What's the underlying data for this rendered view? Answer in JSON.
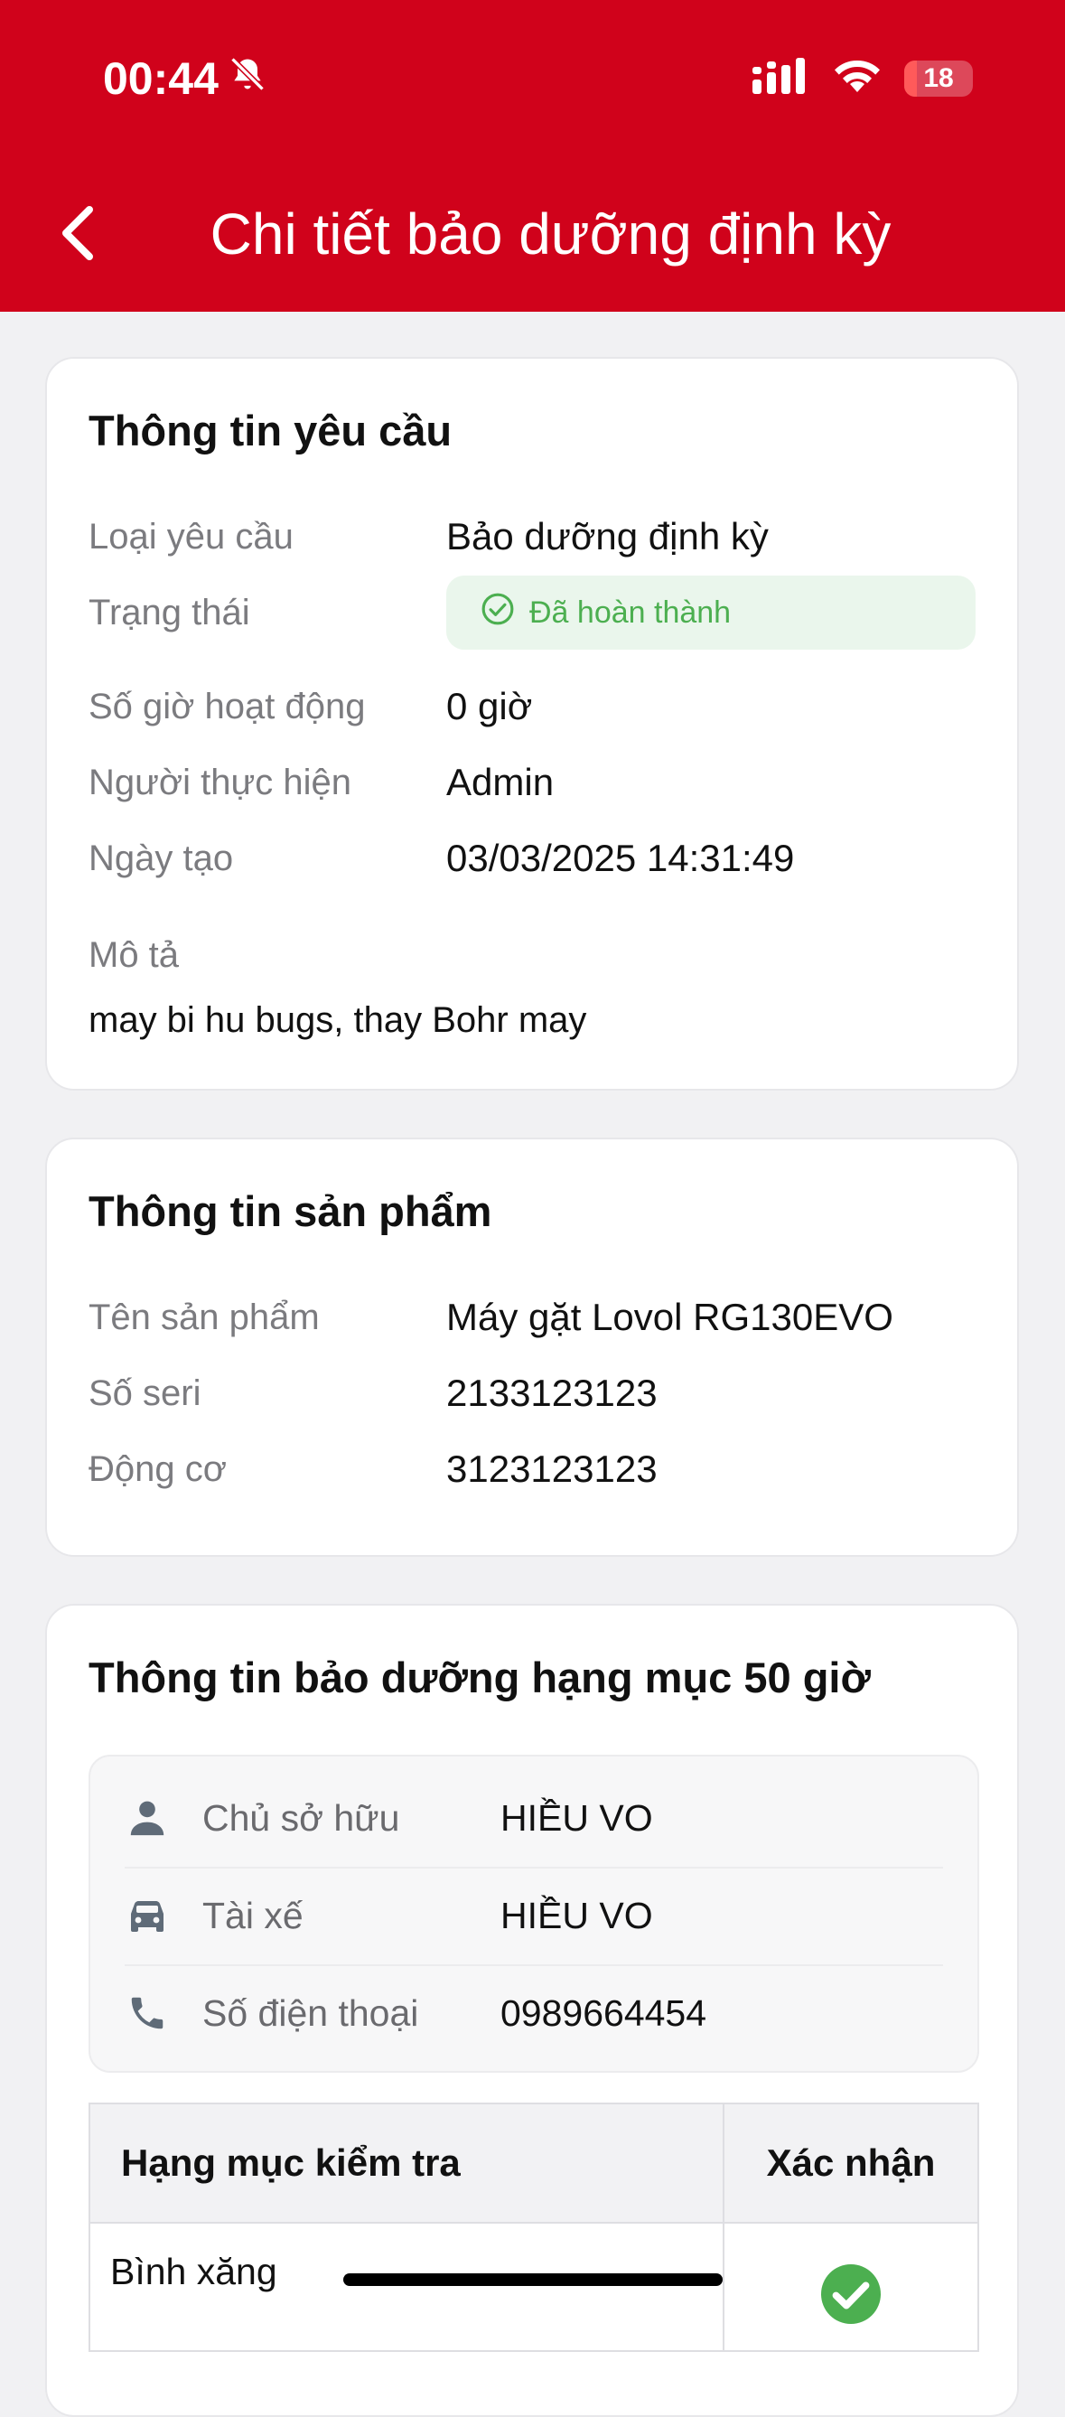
{
  "status_bar": {
    "time": "00:44",
    "battery": "18"
  },
  "nav": {
    "title": "Chi tiết bảo dưỡng định kỳ",
    "back_icon": "chevron-left-icon"
  },
  "request_info": {
    "title": "Thông tin yêu cầu",
    "rows": [
      {
        "label": "Loại yêu cầu",
        "value": "Bảo dưỡng định kỳ"
      },
      {
        "label": "Trạng thái",
        "value": "Đã hoàn thành"
      },
      {
        "label": "Số giờ hoạt động",
        "value": "0 giờ"
      },
      {
        "label": "Người thực hiện",
        "value": "Admin"
      },
      {
        "label": "Ngày tạo",
        "value": "03/03/2025 14:31:49"
      }
    ],
    "desc_label": "Mô tả",
    "desc_value": "may bi hu bugs, thay Bohr may",
    "status_color": "#4caf50"
  },
  "product_info": {
    "title": "Thông tin sản phẩm",
    "rows": [
      {
        "label": "Tên sản phẩm",
        "value": "Máy gặt Lovol RG130EVO"
      },
      {
        "label": "Số seri",
        "value": "2133123123"
      },
      {
        "label": "Động cơ",
        "value": "3123123123"
      }
    ]
  },
  "maintenance_info": {
    "title": "Thông tin bảo dưỡng hạng mục 50 giờ",
    "contacts": [
      {
        "icon": "person-icon",
        "label": "Chủ sở hữu",
        "value": "HIỀU VO"
      },
      {
        "icon": "car-icon",
        "label": "Tài xế",
        "value": "HIỀU VO"
      },
      {
        "icon": "phone-icon",
        "label": "Số điện thoại",
        "value": "0989664454"
      }
    ],
    "table": {
      "headers": [
        "Hạng mục kiểm tra",
        "Xác nhận"
      ],
      "rows": [
        {
          "item": "Bình xăng",
          "confirmed": true
        }
      ]
    }
  },
  "colors": {
    "brand": "#d0021b",
    "success": "#4caf50"
  }
}
